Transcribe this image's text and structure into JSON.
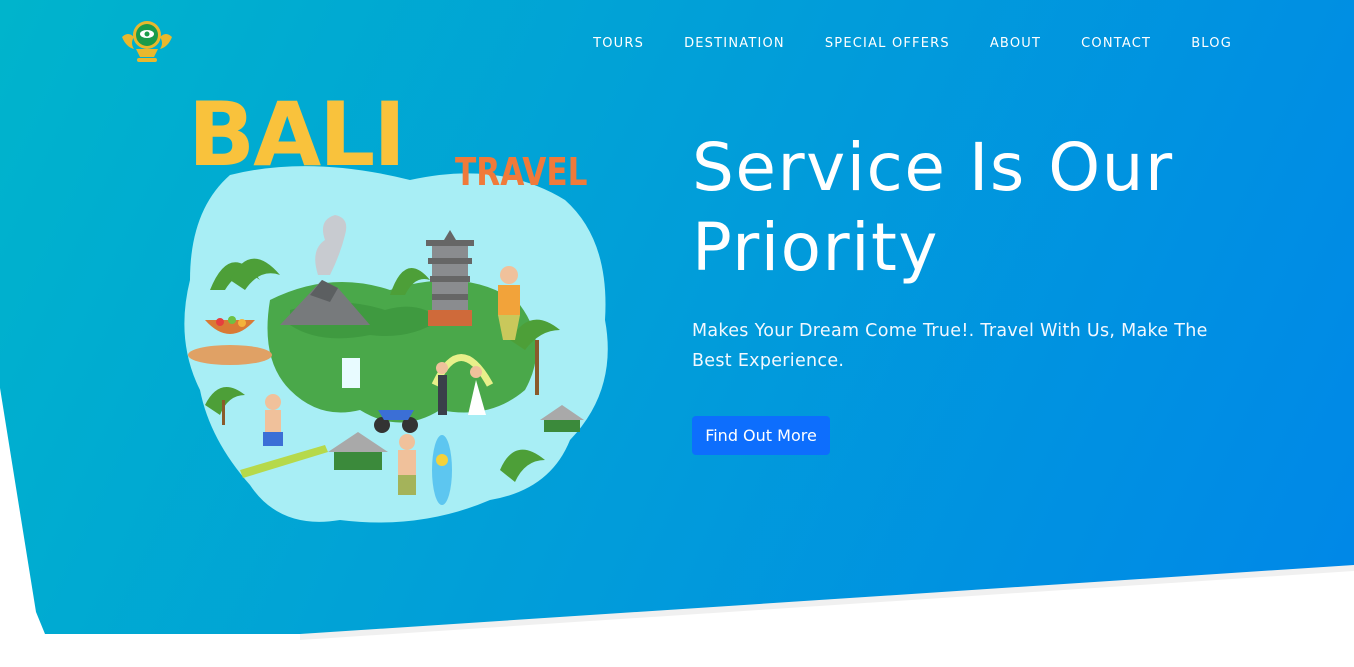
{
  "brand": {
    "logo": "garuda-crest-logo"
  },
  "nav": {
    "items": [
      {
        "label": "TOURS"
      },
      {
        "label": "DESTINATION"
      },
      {
        "label": "SPECIAL OFFERS"
      },
      {
        "label": "ABOUT"
      },
      {
        "label": "CONTACT"
      },
      {
        "label": "BLOG"
      }
    ]
  },
  "hero": {
    "illustration": {
      "big_word": "BALI",
      "small_word": "TRAVEL"
    },
    "headline": "Service Is Our Priority",
    "subtext": "Makes Your Dream Come True!. Travel With Us, Make The Best Experience.",
    "cta_label": "Find Out More"
  },
  "colors": {
    "gradient_start": "#00b4cc",
    "gradient_end": "#0087e8",
    "button": "#0d6efd",
    "bali_yellow": "#f9c23c",
    "travel_orange": "#f07a3a",
    "island": "#a8eef5",
    "land_green": "#4aa84a"
  }
}
